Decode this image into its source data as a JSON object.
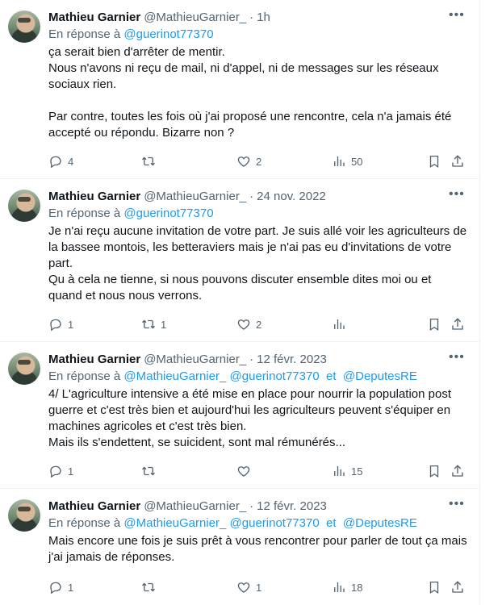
{
  "tweets": [
    {
      "name": "Mathieu Garnier",
      "handle": "@MathieuGarnier_",
      "time": "1h",
      "reply_prefix": "En réponse à ",
      "mentions": [
        "@guerinot77370"
      ],
      "text": "ça serait bien d'arrêter de mentir.\nNous n'avons ni reçu de mail, ni d'appel, ni de messages sur les réseaux sociaux rien.\n\nPar contre, toutes les fois où j'ai proposé une rencontre, cela n'a jamais été accepté ou répondu. Bizarre non ?",
      "replies": "4",
      "retweets": "",
      "likes": "2",
      "views": "50"
    },
    {
      "name": "Mathieu Garnier",
      "handle": "@MathieuGarnier_",
      "time": "24 nov. 2022",
      "reply_prefix": "En réponse à ",
      "mentions": [
        "@guerinot77370"
      ],
      "text": "Je n'ai reçu aucune invitation de votre part. Je suis allé voir les agriculteurs de la bassee montois, les betteraviers mais je n'ai pas eu d'invitations de votre part.\nQu à cela ne tienne, si nous pouvons discuter ensemble dites moi ou et quand et nous nous verrons.",
      "replies": "1",
      "retweets": "1",
      "likes": "2",
      "views": ""
    },
    {
      "name": "Mathieu Garnier",
      "handle": "@MathieuGarnier_",
      "time": "12 févr. 2023",
      "reply_prefix": "En réponse à ",
      "mentions": [
        "@MathieuGarnier_",
        "@guerinot77370",
        "@DeputesRE"
      ],
      "text": "4/ L'agriculture intensive a été mise en place pour nourrir la population post guerre et c'est très bien et aujourd'hui les agriculteurs peuvent s'équiper en machines agricoles et c'est très bien.\nMais ils s'endettent, se suicident, sont mal rémunérés...",
      "replies": "1",
      "retweets": "",
      "likes": "",
      "views": "15"
    },
    {
      "name": "Mathieu Garnier",
      "handle": "@MathieuGarnier_",
      "time": "12 févr. 2023",
      "reply_prefix": "En réponse à ",
      "mentions": [
        "@MathieuGarnier_",
        "@guerinot77370",
        "@DeputesRE"
      ],
      "text": "Mais encore une fois je suis prêt à vous rencontrer pour parler de tout ça mais j'ai jamais de réponses.",
      "replies": "1",
      "retweets": "",
      "likes": "1",
      "views": "18"
    }
  ],
  "ui": {
    "separator": "·",
    "and_word": "et",
    "more_glyph": "•••"
  }
}
